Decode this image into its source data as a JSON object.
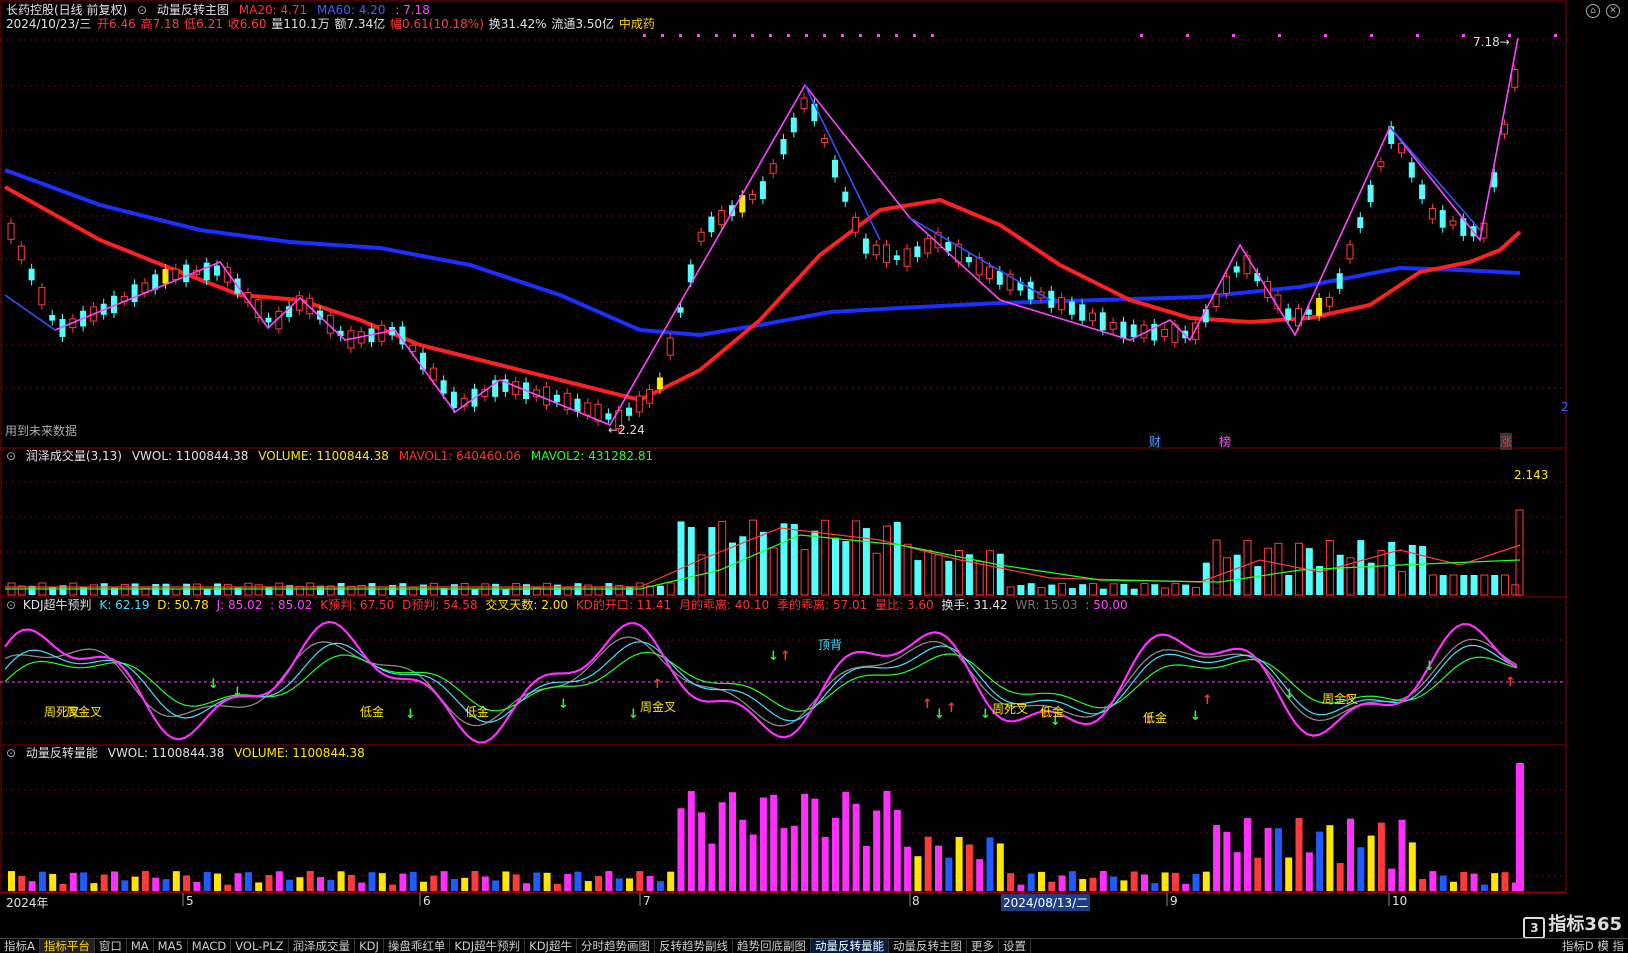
{
  "colors": {
    "up": "#ff3a3a",
    "down": "#54ffff",
    "ma20": "#ff2020",
    "ma60": "#1a30ff",
    "zigzag": "#ff44ff",
    "zigblue": "#3050ff",
    "grid": "#7a0000",
    "yellow": "#ffe600",
    "magenta": "#ff30ff",
    "green": "#22ff22",
    "white": "#ffffff",
    "gray": "#8a8a8a",
    "cyan": "#40e0ff"
  },
  "main": {
    "title": "长药控股(日线 前复权)",
    "formula": "动量反转主图",
    "ma20_label": "MA20: 4.71",
    "ma60_label": "MA60: 4.20",
    "last_price": ": 7.18",
    "date_line": {
      "date": "2024/10/23/三",
      "open": "开6.46",
      "high": "高7.18",
      "low": "低6.21",
      "close": "收6.60",
      "vol": "量110.1万",
      "amount": "额7.34亿",
      "change": "幅0.61(10.18%)",
      "turnover": "换31.42%",
      "float": "流通3.50亿",
      "sector": "中成药"
    },
    "low_marker": "2.24",
    "high_marker": "7.18",
    "future_data_note": "用到未来数据",
    "badges": [
      "财",
      "榜",
      "涨"
    ]
  },
  "volume_panel": {
    "title": "润泽成交量(3,13)",
    "vwol": "VWOL: 1100844.38",
    "volume": "VOLUME: 1100844.38",
    "mavol1": "MAVOL1: 640460.06",
    "mavol2": "MAVOL2: 431282.81",
    "max_label": "2.143"
  },
  "kdj_panel": {
    "title": "KDJ超牛预判",
    "k": "K: 62.19",
    "d": "D: 50.78",
    "j": "J: 85.02",
    "p4": ": 85.02",
    "kpre": "K预判: 67.50",
    "dpre": "D预判: 54.58",
    "cross": "交叉天数: 2.00",
    "kd_open": "KD的开口: 11.41",
    "month_dist": "月的乖离: 40.10",
    "season_dist": "季的乖离: 57.01",
    "ratio": "量比: 3.60",
    "turn": "换手: 31.42",
    "wr": "WR: 15.03",
    "p50": ": 50.00",
    "annotations": [
      "周死叉",
      "周金叉",
      "低金",
      "低金",
      "周金叉",
      "顶背",
      "周死叉",
      "低金",
      "低金",
      "周金叉"
    ]
  },
  "energy_panel": {
    "title": "动量反转量能",
    "vwol": "VWOL: 1100844.38",
    "volume": "VOLUME: 1100844.38"
  },
  "x_axis": {
    "labels": [
      "2024年",
      "5",
      "6",
      "7",
      "8",
      "2024/08/13/二",
      "9",
      "10"
    ]
  },
  "right_axis_label": "2",
  "tabs": [
    "指标A",
    "指标平台",
    "窗口",
    "MA",
    "MA5",
    "MACD",
    "VOL-PLZ",
    "润泽成交量",
    "KDJ",
    "操盘乖红单",
    "KDJ超牛预判",
    "KDJ超牛",
    "分时趋势画图",
    "反转趋势副线",
    "趋势回底副图",
    "动量反转量能",
    "动量反转主图",
    "更多",
    "设置"
  ],
  "tab_right": [
    "指标D",
    "模",
    "指"
  ],
  "logo": "指标365"
}
